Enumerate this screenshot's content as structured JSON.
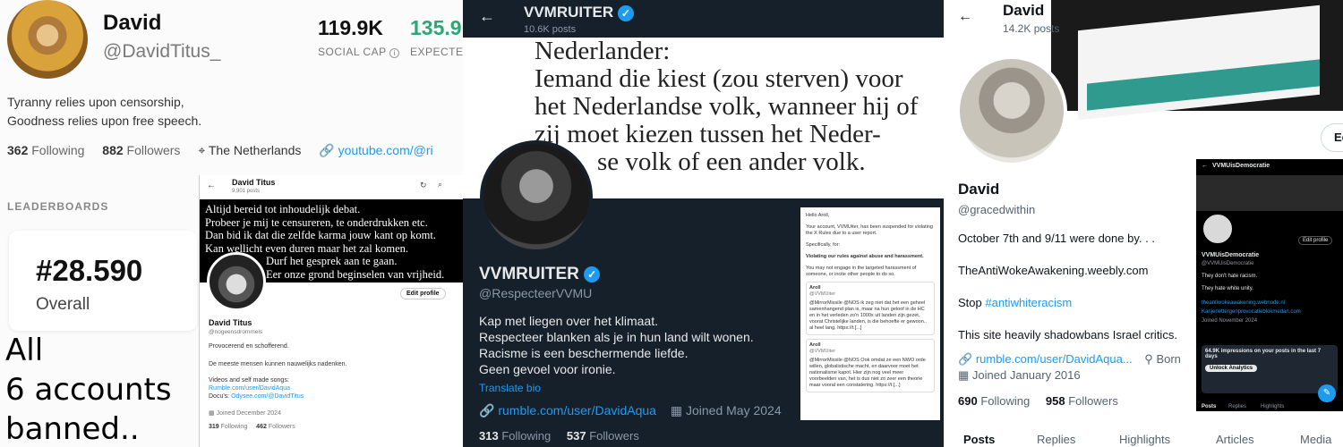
{
  "panel1": {
    "name": "David",
    "handle": "@DavidTitus_",
    "stats": [
      {
        "value": "119.9K",
        "label": "SOCIAL CAP",
        "color": "#111111"
      },
      {
        "value": "135.9",
        "label": "EXPECTED",
        "color": "#2aa876"
      }
    ],
    "bio_lines": [
      "Tyranny relies upon censorship,",
      "Goodness relies upon free speech."
    ],
    "following_count": "362",
    "following_label": "Following",
    "followers_count": "882",
    "followers_label": "Followers",
    "location": "The Netherlands",
    "link": "youtube.com/@ri",
    "leaderboards_label": "LEADERBOARDS",
    "rank": "#28.590",
    "rank_label": "Overall",
    "overlay_lines": [
      "All",
      "6 accounts",
      "banned.."
    ],
    "inset": {
      "title": "David Titus",
      "posts": "9,901 posts",
      "banner_lines": [
        "Altijd bereid tot inhoudelijk debat.",
        "Probeer je mij te censureren, te onderdrukken etc.",
        "Dan bid ik dat die zelfde karma jouw kant op komt.",
        "Kan wellicht even duren maar het zal komen.",
        "Durf het gesprek aan te gaan.",
        "Eer onze grond beginselen van vrijheid."
      ],
      "edit_button": "Edit profile",
      "name": "David Titus",
      "handle": "@nogeensdrommels",
      "bio1": "Provocerend en schofferend.",
      "bio2": "De meeste mensen kunnen nauwelijks nadenken.",
      "bio3": "Videos and self made songs:",
      "link1": "Rumble.com/user/DavidAqua",
      "docu_label": "Docu's:",
      "link2": "Odysee.com/@DavidTitus",
      "joined": "Joined December 2024",
      "following": "319",
      "following_label": "Following",
      "followers": "462",
      "followers_label": "Followers"
    }
  },
  "panel2": {
    "top_name": "VVMRUITER",
    "top_posts": "10.6K posts",
    "banner_lines": [
      "Nederlander:",
      "Iemand die kiest (zou sterven) voor",
      "het Nederlandse volk, wanneer hij of",
      "zij moet kiezen tussen het Neder-",
      "se volk of een ander volk."
    ],
    "name": "VVMRUITER",
    "handle": "@RespecteerVVMU",
    "bio_lines": [
      "Kap met liegen over het klimaat.",
      "Respecteer blanken als je in hun land wilt wonen.",
      "Racisme is een beschermende liefde.",
      "Geen gevoel voor ironie."
    ],
    "translate": "Translate bio",
    "link": "rumble.com/user/DavidAqua",
    "joined": "Joined May 2024",
    "following": "313",
    "following_label": "Following",
    "followers": "537",
    "followers_label": "Followers",
    "notice": {
      "greeting": "Hello Aroll,",
      "p1": "Your account, VVMUiter, has been suspended for violating the X Rules due to a user report.",
      "p2": "Specifically, for:",
      "p3": "Violating our rules against abuse and harassment.",
      "p4": "You may not engage in the targeted harassment of someone, or incite other people to do so.",
      "tweet1_name": "Aroll",
      "tweet1_handle": "@VVMUiter",
      "tweet1_text": "@MirrorMissile @NOS ik zeg niet dat het een geheel samenhangend plan is, maar na hun geloof in de HC en in het verleden zo'n 1000x uit landen zijn gezet, voorat Christelijke landen, is die behoefte er gewoon.. al heel lang. https://t.[...]",
      "tweet2_name": "Aroll",
      "tweet2_handle": "@VVMUiter",
      "tweet2_text": "@MirrorMissile @NOS Ook omdat ze een NWO orde willen, globalistische macht, en daarvoor moet het nationalisme kapot. Hier zijn nog veel meer voorbeelden van, het is dus niet zo zeer een theorie maar vooral een constatering. https://t.[...]"
    }
  },
  "panel3": {
    "top_name": "David",
    "top_posts": "14.2K posts",
    "edit_partial": "Ec",
    "name": "David",
    "handle": "@gracedwithin",
    "bio1": "October 7th and 9/11 were done by. . .",
    "link1": "TheAntiWokeAwakening.weebly.com",
    "stop_word": "Stop",
    "hashtag": "#antiwhiteracism",
    "bio2": "This site heavily shadowbans Israel critics.",
    "link2": "rumble.com/user/DavidAqua...",
    "born_partial": "Born",
    "joined": "Joined January 2016",
    "following": "690",
    "following_label": "Following",
    "followers": "958",
    "followers_label": "Followers",
    "tabs": [
      "Posts",
      "Replies",
      "Highlights",
      "Articles",
      "Media"
    ],
    "inset": {
      "title": "VVMUisDemocratie",
      "edit_button": "Edit profile",
      "name": "VVMUisDemocratie",
      "handle": "@VVMUisDemocratie",
      "line1": "They don't hate racism.",
      "line2": "They hate white unity.",
      "link1": "theantiwokeawakening.webnode.nl",
      "link2": "Kanjerlettergenprovocatieblokmedan.com",
      "joined": "Joined November 2024",
      "impressions": "64.9K impressions on your posts in the last 7 days",
      "unlock": "Unlock Analytics",
      "tabs": [
        "Posts",
        "Replies",
        "Highlights"
      ]
    }
  }
}
